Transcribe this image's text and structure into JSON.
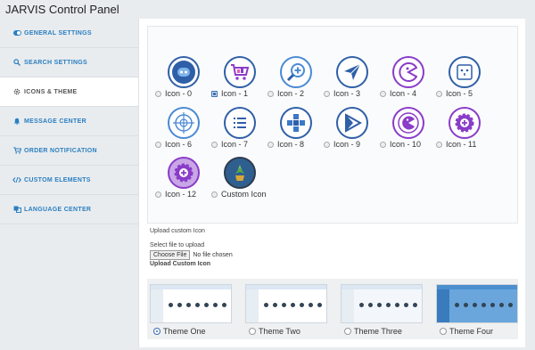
{
  "app": {
    "title": "JARVIS Control Panel"
  },
  "sidebar": {
    "items": [
      {
        "label": "GENERAL SETTINGS",
        "icon": "toggle-icon",
        "active": false
      },
      {
        "label": "SEARCH SETTINGS",
        "icon": "search-icon",
        "active": false
      },
      {
        "label": "ICONS & THEME",
        "icon": "gear-icon",
        "active": true
      },
      {
        "label": "MESSAGE CENTER",
        "icon": "bell-icon",
        "active": false
      },
      {
        "label": "ORDER NOTIFICATION",
        "icon": "cart-icon",
        "active": false
      },
      {
        "label": "CUSTOM ELEMENTS",
        "icon": "code-icon",
        "active": false
      },
      {
        "label": "LANGUAGE CENTER",
        "icon": "language-icon",
        "active": false
      }
    ]
  },
  "icons": {
    "items": [
      {
        "label": "Icon - 0"
      },
      {
        "label": "Icon - 1"
      },
      {
        "label": "Icon - 2"
      },
      {
        "label": "Icon - 3"
      },
      {
        "label": "Icon - 4"
      },
      {
        "label": "Icon - 5"
      },
      {
        "label": "Icon - 6"
      },
      {
        "label": "Icon - 7"
      },
      {
        "label": "Icon - 8"
      },
      {
        "label": "Icon - 9"
      },
      {
        "label": "Icon - 10"
      },
      {
        "label": "Icon - 11"
      },
      {
        "label": "Icon - 12"
      },
      {
        "label": "Custom Icon"
      }
    ],
    "selected": "Icon - 1"
  },
  "upload": {
    "title": "Upload custom Icon",
    "select_label": "Select file to upload",
    "button_label": "Choose File",
    "no_file_text": "No file chosen",
    "heading": "Upload Custom Icon"
  },
  "themes": {
    "items": [
      {
        "label": "Theme One"
      },
      {
        "label": "Theme Two"
      },
      {
        "label": "Theme Three"
      },
      {
        "label": "Theme Four"
      }
    ],
    "selected": "Theme One"
  },
  "colors": {
    "accent": "#2a7fc1",
    "icon_blue": "#2f5fa8",
    "icon_purple": "#8a3cc9"
  }
}
